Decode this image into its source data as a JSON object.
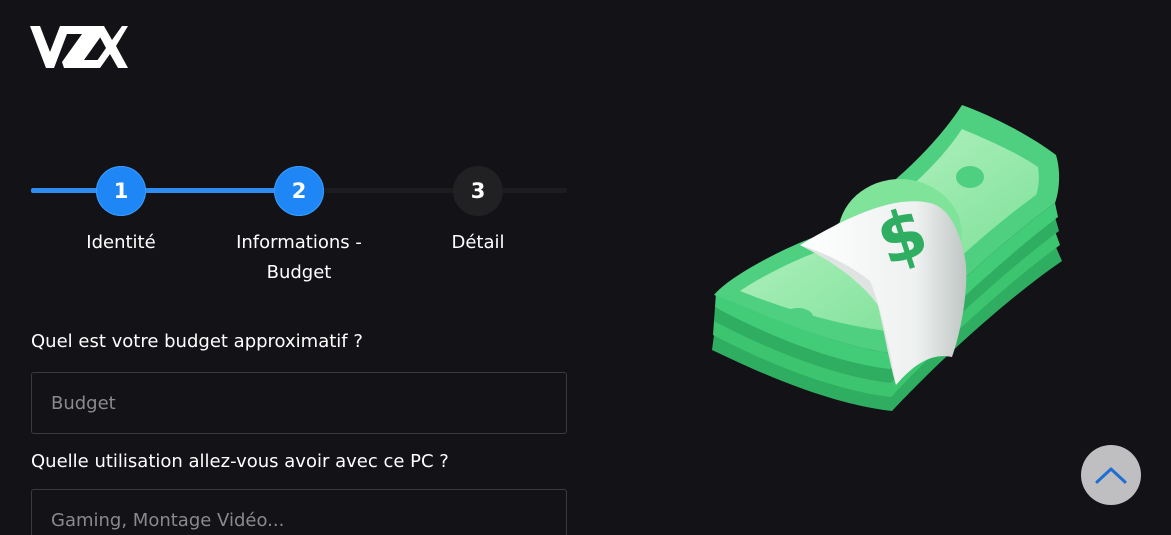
{
  "brand": {
    "logo_text": "VZX"
  },
  "stepper": {
    "steps": [
      {
        "number": "1",
        "label": "Identité",
        "state": "completed"
      },
      {
        "number": "2",
        "label": "Informations - Budget",
        "state": "active"
      },
      {
        "number": "3",
        "label": "Détail",
        "state": "pending"
      }
    ],
    "colors": {
      "active": "#1f87f5",
      "inactive": "#212023",
      "track_done": "#2f8df2",
      "track_todo": "#1c1c1f"
    }
  },
  "form": {
    "budget_question": "Quel est votre budget approximatif ?",
    "budget_placeholder": "Budget",
    "usage_question": "Quelle utilisation allez-vous avoir avec ce PC ?",
    "usage_placeholder": "Gaming, Montage Vidéo..."
  },
  "illustration": {
    "name": "money-stack-illustration",
    "symbol": "$"
  },
  "scroll_top": {
    "icon": "chevron-up-icon"
  }
}
